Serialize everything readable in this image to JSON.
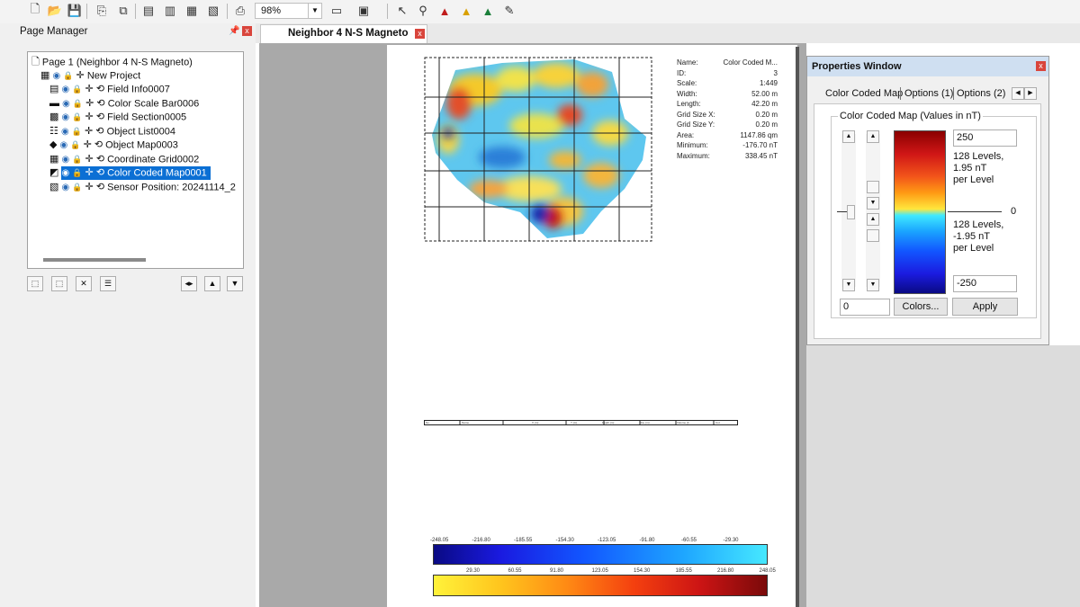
{
  "toolbar": {
    "zoom_value": "98%"
  },
  "page_manager": {
    "title": "Page Manager",
    "items": [
      {
        "label": "Page 1 (Neighbor 4 N-S Magneto)"
      },
      {
        "label": "New Project"
      },
      {
        "label": "Field Info0007"
      },
      {
        "label": "Color Scale Bar0006"
      },
      {
        "label": "Field Section0005"
      },
      {
        "label": "Object List0004"
      },
      {
        "label": "Object Map0003"
      },
      {
        "label": "Coordinate Grid0002"
      },
      {
        "label": "Color Coded Map0001"
      },
      {
        "label": "Sensor Position: 20241114_2"
      }
    ]
  },
  "document": {
    "tab_label": "Neighbor 4 N-S Magneto"
  },
  "field_info": [
    {
      "key": "Name:",
      "value": "Color Coded M..."
    },
    {
      "key": "ID:",
      "value": "3"
    },
    {
      "key": "Scale:",
      "value": "1:449"
    },
    {
      "key": "Width:",
      "value": "52.00 m"
    },
    {
      "key": "Length:",
      "value": "42.20 m"
    },
    {
      "key": "Grid Size X:",
      "value": "0.20 m"
    },
    {
      "key": "Grid Size Y:",
      "value": "0.20 m"
    },
    {
      "key": "Area:",
      "value": "1147.86 qm"
    },
    {
      "key": "Minimum:",
      "value": "-176.70 nT"
    },
    {
      "key": "Maximum:",
      "value": "338.45 nT"
    }
  ],
  "object_list_headers": [
    "No.",
    "Name",
    "X (m)",
    "Y (m)",
    "Depth (m)",
    "Dia. (m)",
    "Volume (l)",
    "Col."
  ],
  "scale_bar": {
    "negative_labels": [
      "-248.05",
      "-216.80",
      "-185.55",
      "-154.30",
      "-123.05",
      "-91.80",
      "-60.55",
      "-29.30"
    ],
    "positive_labels": [
      "29.30",
      "60.55",
      "91.80",
      "123.05",
      "154.30",
      "185.55",
      "216.80",
      "248.05"
    ]
  },
  "properties": {
    "title": "Properties Window",
    "tabs": [
      "Color Coded Map",
      "Options (1)",
      "Options (2)"
    ],
    "group_title": "Color Coded Map (Values in nT)",
    "max_value": "250",
    "min_value": "-250",
    "offset_value": "0",
    "zero_label": "0",
    "upper_levels": [
      "128 Levels,",
      "1.95 nT",
      "per Level"
    ],
    "lower_levels": [
      "128 Levels,",
      "-1.95 nT",
      "per Level"
    ],
    "colors_button": "Colors...",
    "apply_button": "Apply"
  }
}
